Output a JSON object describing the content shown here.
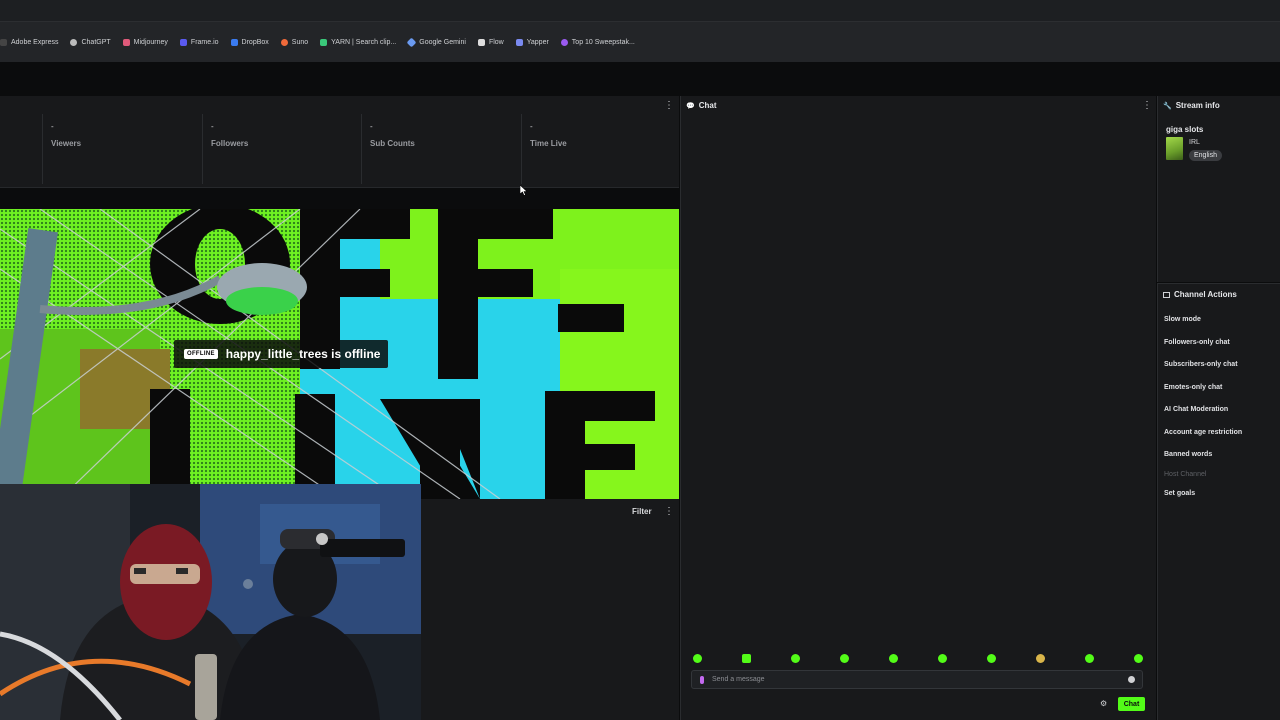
{
  "bookmarks": [
    {
      "label": "Adobe Express",
      "icon": "adobe-express-icon",
      "color": "#444444"
    },
    {
      "label": "ChatGPT",
      "icon": "chatgpt-icon",
      "color": "#bbbbbb"
    },
    {
      "label": "Midjourney",
      "icon": "midjourney-icon",
      "color": "#e05a7a"
    },
    {
      "label": "Frame.io",
      "icon": "frameio-icon",
      "color": "#5a5af0"
    },
    {
      "label": "DropBox",
      "icon": "dropbox-icon",
      "color": "#3a7bf0"
    },
    {
      "label": "Suno",
      "icon": "suno-icon",
      "color": "#f06a3a"
    },
    {
      "label": "YARN | Search clip...",
      "icon": "yarn-icon",
      "color": "#3ac87a"
    },
    {
      "label": "Google Gemini",
      "icon": "gemini-icon",
      "color": "#6a9af0"
    },
    {
      "label": "Flow",
      "icon": "flow-icon",
      "color": "#dddddd"
    },
    {
      "label": "Yapper",
      "icon": "yapper-icon",
      "color": "#7a8af0"
    },
    {
      "label": "Top 10 Sweepstak...",
      "icon": "sweepstakes-icon",
      "color": "#9a5af0"
    }
  ],
  "stats": [
    {
      "value": "-",
      "label": "Viewers"
    },
    {
      "value": "-",
      "label": "Followers"
    },
    {
      "value": "-",
      "label": "Sub Counts"
    },
    {
      "value": "-",
      "label": "Time Live"
    }
  ],
  "player": {
    "badge": "OFFLINE",
    "status_text": "happy_little_trees is offline"
  },
  "lower_panel": {
    "filter_label": "Filter"
  },
  "chat": {
    "title": "Chat",
    "placeholder": "Send a message",
    "send_label": "Chat"
  },
  "stream_info": {
    "title": "Stream info",
    "stream_title": "giga slots",
    "category": "IRL",
    "language_tag": "English"
  },
  "channel_actions": {
    "title": "Channel Actions",
    "items": [
      {
        "label": "Slow mode",
        "enabled": true
      },
      {
        "label": "Followers-only chat",
        "enabled": true
      },
      {
        "label": "Subscribers-only chat",
        "enabled": true
      },
      {
        "label": "Emotes-only chat",
        "enabled": true
      },
      {
        "label": "AI Chat Moderation",
        "enabled": true
      },
      {
        "label": "Account age restriction",
        "enabled": true
      },
      {
        "label": "Banned words",
        "enabled": true
      },
      {
        "label": "Host Channel",
        "enabled": false
      },
      {
        "label": "Set goals",
        "enabled": true
      }
    ]
  },
  "colors": {
    "accent": "#53fc18",
    "panel": "#18191b",
    "background": "#0b0c0d"
  }
}
